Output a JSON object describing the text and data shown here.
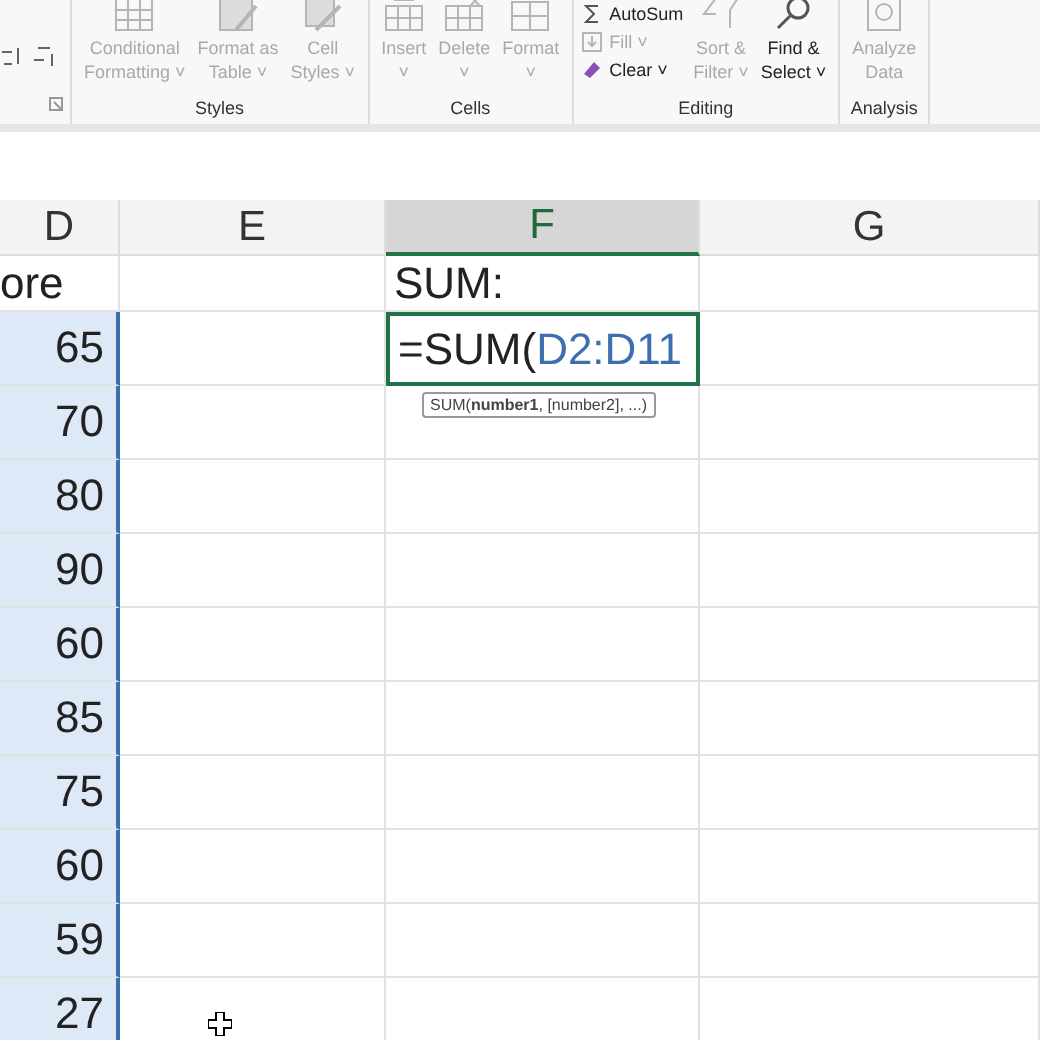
{
  "ribbon": {
    "groups": [
      {
        "label": "Styles",
        "items": [
          {
            "kind": "big",
            "lines": [
              "Conditional",
              "Formatting ˅"
            ],
            "disabled": true
          },
          {
            "kind": "big",
            "lines": [
              "Format as",
              "Table ˅"
            ],
            "disabled": true
          },
          {
            "kind": "big",
            "lines": [
              "Cell",
              "Styles ˅"
            ],
            "disabled": true
          }
        ]
      },
      {
        "label": "Cells",
        "items": [
          {
            "kind": "big",
            "lines": [
              "Insert",
              "˅"
            ],
            "disabled": true
          },
          {
            "kind": "big",
            "lines": [
              "Delete",
              "˅"
            ],
            "disabled": true
          },
          {
            "kind": "big",
            "lines": [
              "Format",
              "˅"
            ],
            "disabled": true
          }
        ]
      },
      {
        "label": "Editing",
        "items": [
          {
            "kind": "stack",
            "entries": [
              {
                "label": "AutoSum",
                "disabled": false
              },
              {
                "label": "Fill ˅",
                "disabled": true
              },
              {
                "label": "Clear ˅",
                "disabled": false
              }
            ]
          },
          {
            "kind": "big",
            "lines": [
              "Sort &",
              "Filter ˅"
            ],
            "disabled": true
          },
          {
            "kind": "big",
            "lines": [
              "Find &",
              "Select ˅"
            ],
            "disabled": false
          }
        ]
      },
      {
        "label": "Analysis",
        "items": [
          {
            "kind": "big",
            "lines": [
              "Analyze",
              "Data"
            ],
            "disabled": true
          }
        ]
      }
    ]
  },
  "columns": [
    {
      "label": "D",
      "selected": false
    },
    {
      "label": "E",
      "selected": false
    },
    {
      "label": "F",
      "selected": true
    },
    {
      "label": "G",
      "selected": false
    }
  ],
  "rows": [
    {
      "d": "ore",
      "in_range": false,
      "f": "SUM:"
    },
    {
      "d": "65",
      "in_range": true,
      "formula": {
        "text": "=SUM(",
        "ref": "D2:D11"
      },
      "tooltip": "SUM(**number1**, [number2], ...)"
    },
    {
      "d": "70",
      "in_range": true
    },
    {
      "d": "80",
      "in_range": true
    },
    {
      "d": "90",
      "in_range": true
    },
    {
      "d": "60",
      "in_range": true
    },
    {
      "d": "85",
      "in_range": true
    },
    {
      "d": "75",
      "in_range": true
    },
    {
      "d": "60",
      "in_range": true
    },
    {
      "d": "59",
      "in_range": true
    },
    {
      "d": "27",
      "in_range": true
    }
  ]
}
